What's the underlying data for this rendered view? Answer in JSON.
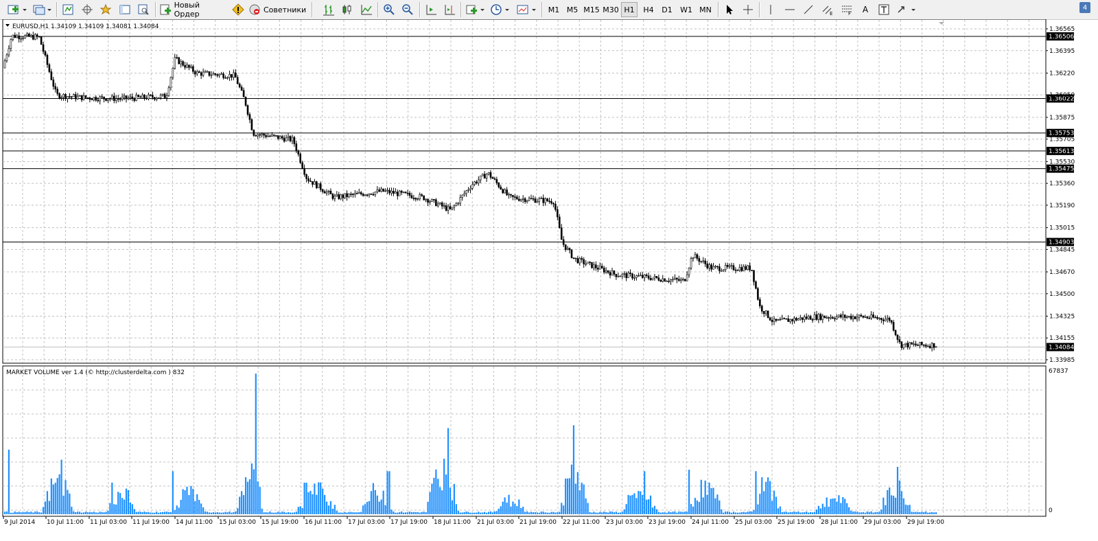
{
  "toolbar": {
    "new_order_label": "Новый Ордер",
    "advisors_label": "Советники",
    "timeframes": [
      "M1",
      "M5",
      "M15",
      "M30",
      "H1",
      "H4",
      "D1",
      "W1",
      "MN"
    ],
    "active_timeframe": "H1",
    "text_tool_label": "A",
    "window_badge": "4"
  },
  "chart": {
    "symbol_header": "EURUSD,H1  1.34109 1.34109 1.34081 1.34084",
    "price_ticks": [
      "1.36565",
      "1.36395",
      "1.36220",
      "1.36050",
      "1.35875",
      "1.35705",
      "1.35530",
      "1.35360",
      "1.35190",
      "1.35015",
      "1.34845",
      "1.34670",
      "1.34500",
      "1.34325",
      "1.34155",
      "1.33985"
    ],
    "level_labels": [
      "1.36506",
      "1.36022",
      "1.35753",
      "1.35613",
      "1.35475",
      "1.34903"
    ],
    "current_price": "1.34084",
    "time_labels": [
      "9 Jul 2014",
      "10 Jul 11:00",
      "11 Jul 03:00",
      "11 Jul 19:00",
      "14 Jul 11:00",
      "15 Jul 03:00",
      "15 Jul 19:00",
      "16 Jul 11:00",
      "17 Jul 03:00",
      "17 Jul 19:00",
      "18 Jul 11:00",
      "21 Jul 03:00",
      "21 Jul 19:00",
      "22 Jul 11:00",
      "23 Jul 03:00",
      "23 Jul 19:00",
      "24 Jul 11:00",
      "25 Jul 03:00",
      "25 Jul 19:00",
      "28 Jul 11:00",
      "29 Jul 03:00",
      "29 Jul 19:00"
    ]
  },
  "indicator": {
    "title": "MARKET VOLUME ver 1.4 (© http://clusterdelta.com ) 832",
    "max_label": "67837",
    "min_label": "0"
  },
  "colors": {
    "volume_bar": "#1e90ff",
    "grid": "#c0c0c0",
    "candle": "#000000",
    "label_bg": "#000000"
  }
}
